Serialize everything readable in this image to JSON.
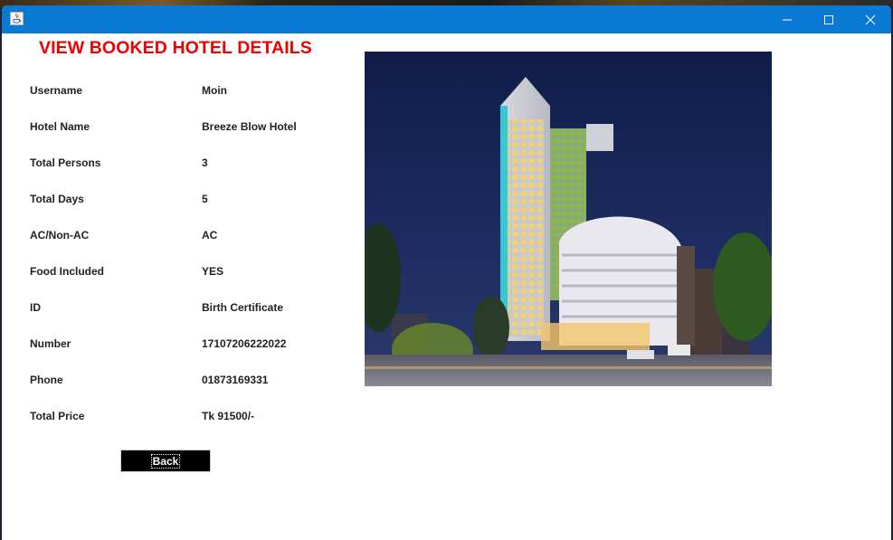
{
  "window": {
    "title": "",
    "controls": [
      "minimize-icon",
      "maximize-icon",
      "close-icon"
    ]
  },
  "page": {
    "heading": "VIEW BOOKED HOTEL DETAILS",
    "heading_color": "#ee0000"
  },
  "details": [
    {
      "label": "Username",
      "value": "Moin"
    },
    {
      "label": "Hotel Name",
      "value": "Breeze Blow Hotel"
    },
    {
      "label": "Total Persons",
      "value": "3"
    },
    {
      "label": "Total Days",
      "value": "5"
    },
    {
      "label": "AC/Non-AC",
      "value": "AC"
    },
    {
      "label": "Food Included",
      "value": "YES"
    },
    {
      "label": "ID",
      "value": "Birth Certificate"
    },
    {
      "label": "Number",
      "value": "17107206222022"
    },
    {
      "label": "Phone",
      "value": "01873169331"
    },
    {
      "label": "Total Price",
      "value": "Tk 91500/-"
    }
  ],
  "actions": {
    "back_label": "Back"
  },
  "colors": {
    "titlebar": "#0a79d3",
    "button_bg": "#000000",
    "text": "#222222"
  }
}
